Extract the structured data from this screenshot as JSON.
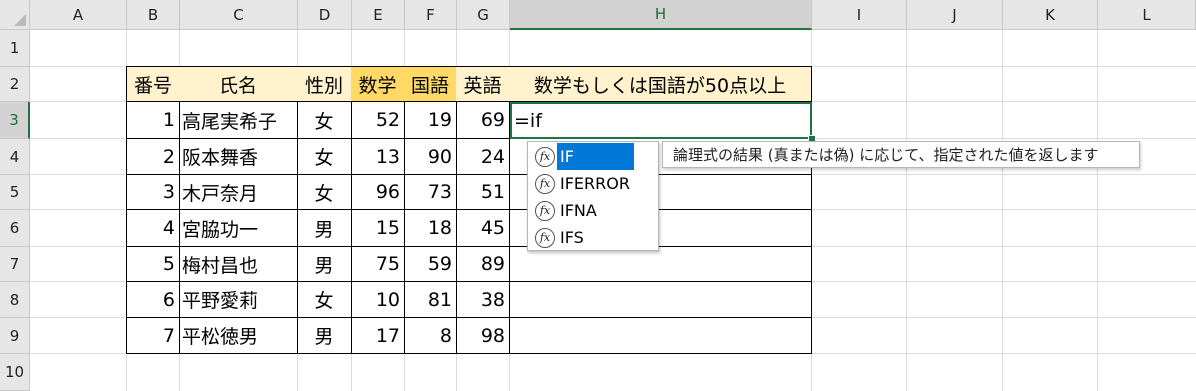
{
  "columns": [
    "A",
    "B",
    "C",
    "D",
    "E",
    "F",
    "G",
    "H",
    "I",
    "J",
    "K",
    "L"
  ],
  "rows": [
    "1",
    "2",
    "3",
    "4",
    "5",
    "6",
    "7",
    "8",
    "9",
    "10"
  ],
  "selected_column": "H",
  "selected_row": "3",
  "table": {
    "headers": [
      "番号",
      "氏名",
      "性別",
      "数学",
      "国語",
      "英語",
      "数学もしくは国語が50点以上"
    ],
    "rows": [
      [
        "1",
        "高尾実希子",
        "女",
        "52",
        "19",
        "69"
      ],
      [
        "2",
        "阪本舞香",
        "女",
        "13",
        "90",
        "24"
      ],
      [
        "3",
        "木戸奈月",
        "女",
        "96",
        "73",
        "51"
      ],
      [
        "4",
        "宮脇功一",
        "男",
        "15",
        "18",
        "45"
      ],
      [
        "5",
        "梅村昌也",
        "男",
        "75",
        "59",
        "89"
      ],
      [
        "6",
        "平野愛莉",
        "女",
        "10",
        "81",
        "38"
      ],
      [
        "7",
        "平松徳男",
        "男",
        "17",
        "8",
        "98"
      ]
    ]
  },
  "active_cell": {
    "input": "=if"
  },
  "autocomplete": {
    "icon": "function-icon",
    "icon_glyph": "fx",
    "items": [
      "IF",
      "IFERROR",
      "IFNA",
      "IFS"
    ],
    "highlighted": "IF",
    "tooltip": "論理式の結果 (真または偽) に応じて、指定された値を返します"
  },
  "colors": {
    "header_fill": "#fff2cc",
    "highlight_header_fill": "#ffd966",
    "selection_accent": "#217346",
    "autocomplete_highlight": "#0078d7"
  }
}
